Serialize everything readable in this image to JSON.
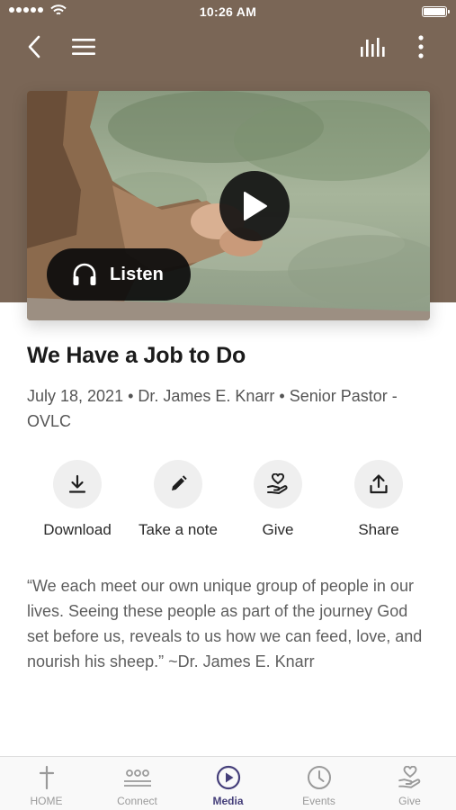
{
  "status_bar": {
    "time": "10:26 AM"
  },
  "nav": {
    "back_icon": "chevron-left-icon",
    "menu_icon": "hamburger-icon",
    "audio_icon": "audio-bars-icon",
    "more_icon": "more-vertical-icon"
  },
  "media": {
    "listen_label": "Listen",
    "play_icon": "play-icon",
    "headphones_icon": "headphones-icon"
  },
  "sermon": {
    "title": "We Have a Job to Do",
    "meta": "July 18, 2021 • Dr. James E. Knarr • Senior Pastor - OVLC",
    "quote": "“We each meet our own unique group of people in our lives. Seeing these people as part of the journey God set before us, reveals to us how we can feed, love, and nourish his sheep.” ~Dr. James E. Knarr"
  },
  "actions": [
    {
      "label": "Download",
      "icon": "download-icon"
    },
    {
      "label": "Take a note",
      "icon": "pencil-icon"
    },
    {
      "label": "Give",
      "icon": "hand-heart-icon"
    },
    {
      "label": "Share",
      "icon": "share-icon"
    }
  ],
  "tabs": [
    {
      "label": "HOME",
      "icon": "cross-icon"
    },
    {
      "label": "Connect",
      "icon": "people-icon"
    },
    {
      "label": "Media",
      "icon": "play-circle-icon",
      "active": true
    },
    {
      "label": "Events",
      "icon": "clock-icon"
    },
    {
      "label": "Give",
      "icon": "hand-heart-icon"
    }
  ],
  "colors": {
    "header_brown": "#7a6656",
    "active_tab": "#453f7a",
    "inactive_tab": "#9a9a9a"
  }
}
